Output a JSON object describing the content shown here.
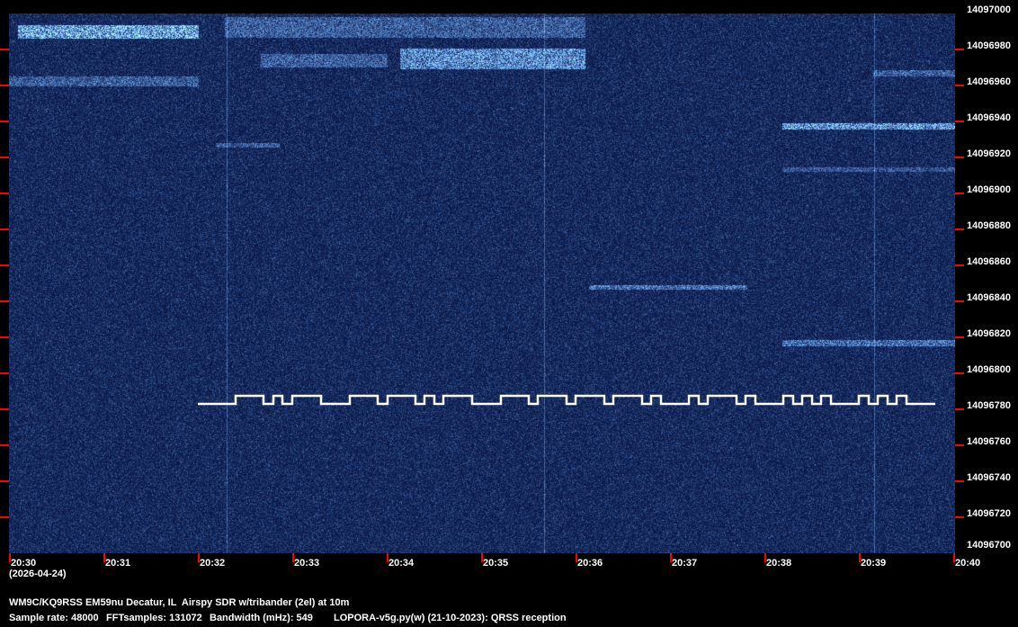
{
  "chart_data": {
    "type": "heatmap",
    "title": "QRSS spectrogram",
    "x_label_date": "(2026-04-24)",
    "x_ticks": [
      "20:30",
      "20:31",
      "20:32",
      "20:33",
      "20:34",
      "20:35",
      "20:36",
      "20:37",
      "20:38",
      "20:39",
      "20:40"
    ],
    "y_ticks": [
      "14097000",
      "14096980",
      "14096960",
      "14096940",
      "14096920",
      "14096900",
      "14096880",
      "14096860",
      "14096840",
      "14096820",
      "14096800",
      "14096780",
      "14096760",
      "14096740",
      "14096720",
      "14096700"
    ],
    "ylim": [
      14096700,
      14097000
    ],
    "xlim_minutes": [
      0,
      10
    ],
    "colors": {
      "background": "#0a1a48",
      "signal": "#ffffff",
      "tick": "#ff0000"
    }
  },
  "footer": {
    "station": "WM9C/KQ9RSS EM59nu Decatur, IL  Airspy SDR w/tribander (2el) at 10m",
    "sample_rate": "Sample rate: 48000",
    "fft_samples": "FFTsamples: 131072",
    "bandwidth": "Bandwidth (mHz): 549",
    "software": "LOPORA-v5g.py(w) (21-10-2023): QRSS reception"
  }
}
